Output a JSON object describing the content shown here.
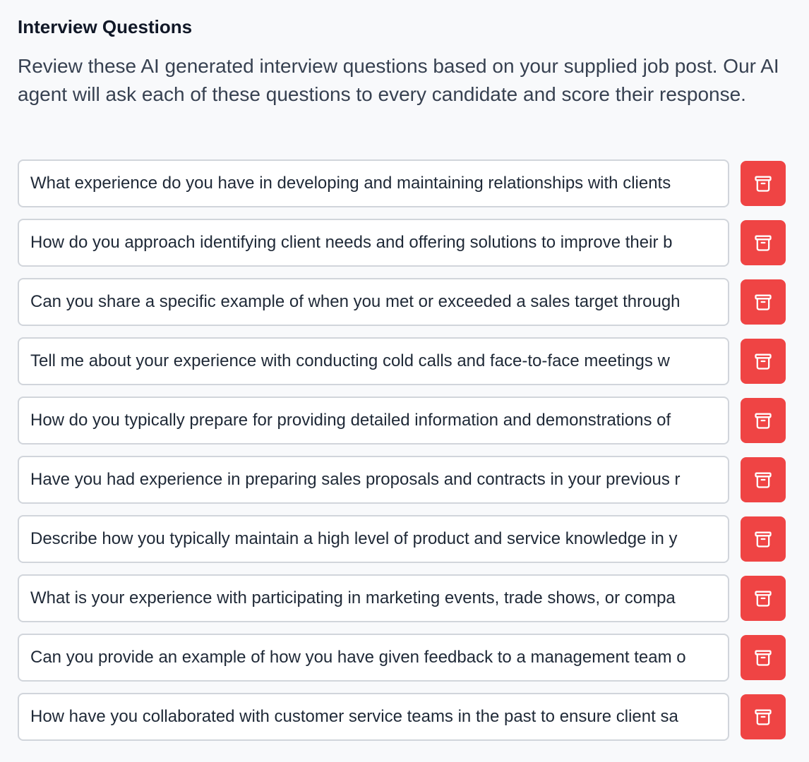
{
  "header": {
    "title": "Interview Questions",
    "description": "Review these AI generated interview questions based on your supplied job post. Our AI agent will ask each of these questions to every candidate and score their response."
  },
  "questions": [
    "What experience do you have in developing and maintaining relationships with clients",
    "How do you approach identifying client needs and offering solutions to improve their b",
    "Can you share a specific example of when you met or exceeded a sales target through",
    "Tell me about your experience with conducting cold calls and face-to-face meetings w",
    "How do you typically prepare for providing detailed information and demonstrations of",
    "Have you had experience in preparing sales proposals and contracts in your previous r",
    "Describe how you typically maintain a high level of product and service knowledge in y",
    "What is your experience with participating in marketing events, trade shows, or compa",
    "Can you provide an example of how you have given feedback to a management team o",
    "How have you collaborated with customer service teams in the past to ensure client sa"
  ],
  "delete_button": {
    "icon": "archive-icon",
    "color": "#ef4444"
  }
}
